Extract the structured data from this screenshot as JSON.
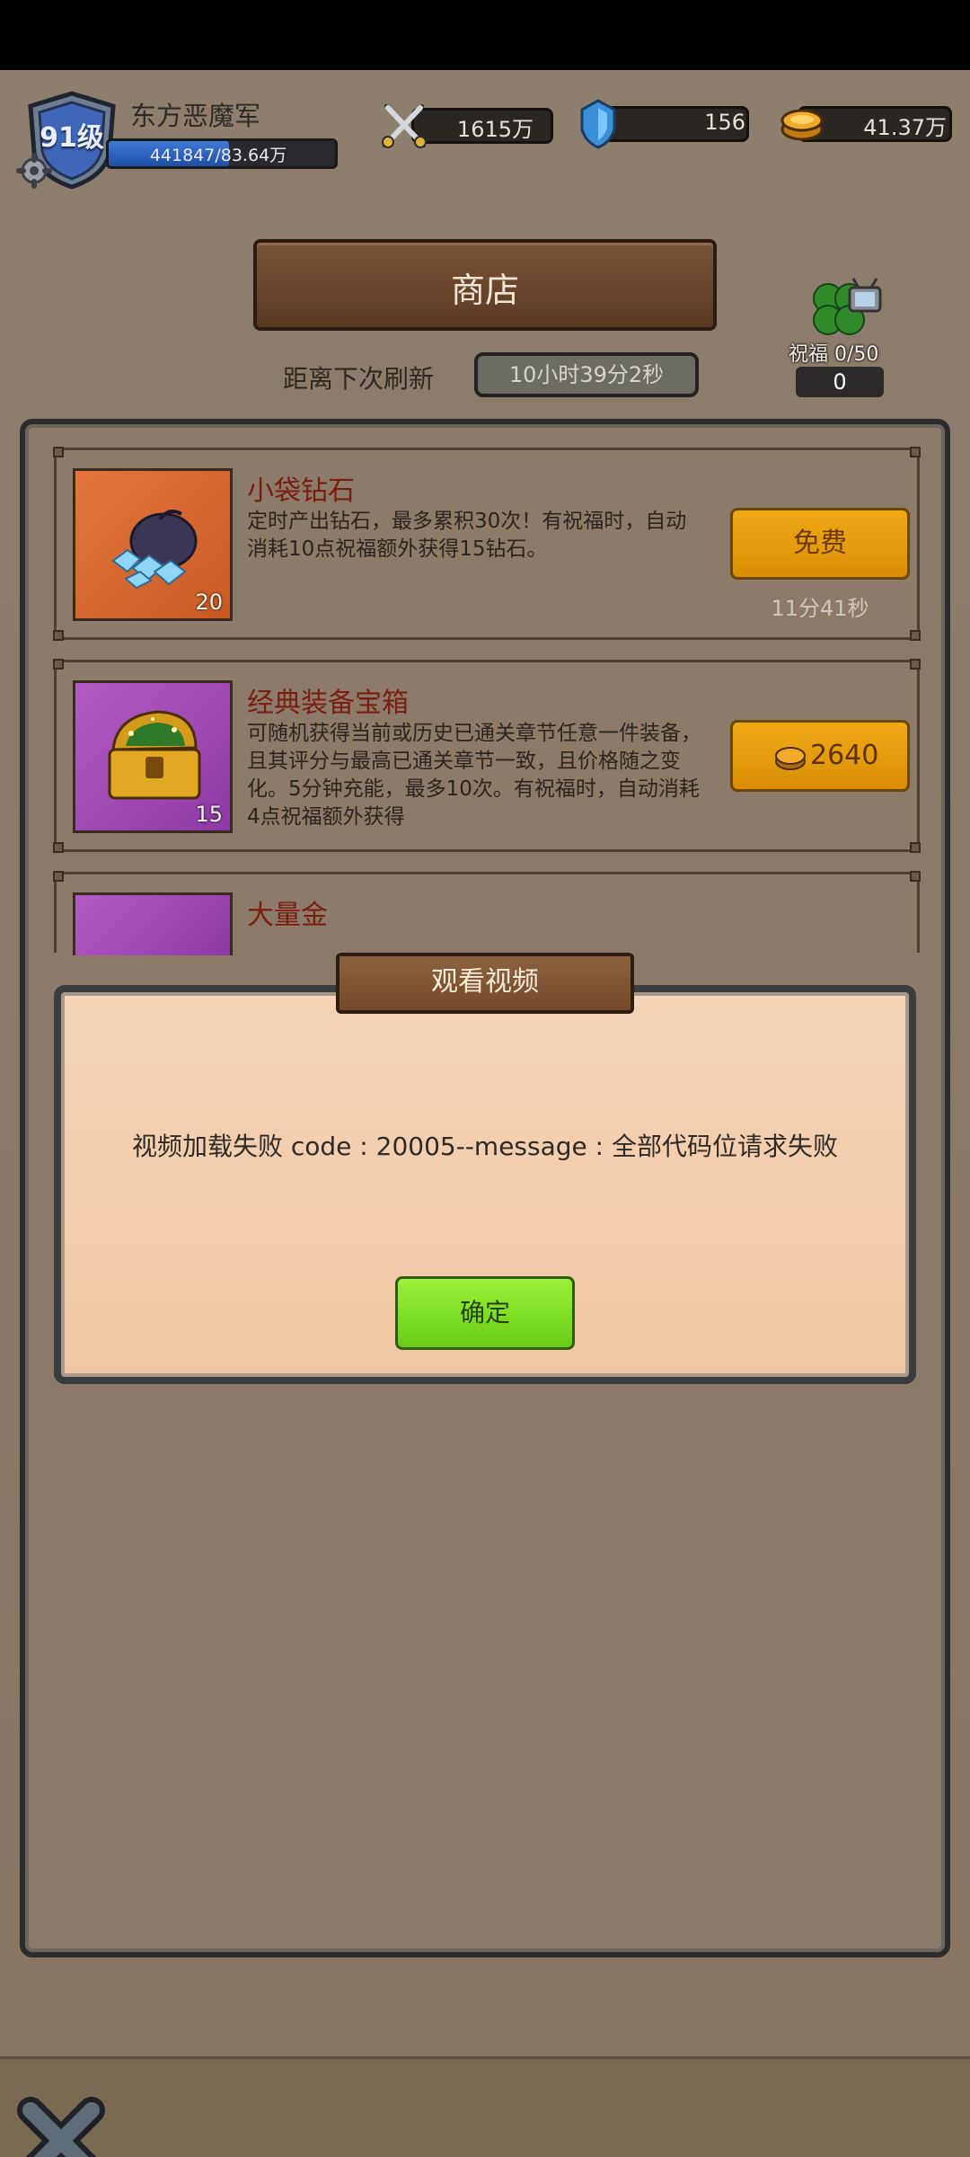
{
  "player": {
    "level": "91级",
    "name": "东方恶魔军",
    "xp_text": "441847/83.64万",
    "xp_fraction": 0.53
  },
  "resources": {
    "power": "1615万",
    "diamonds": "156",
    "gold": "41.37万"
  },
  "shop": {
    "title": "商店",
    "refresh_label": "距离下次刷新",
    "refresh_timer": "10小时39分2秒"
  },
  "blessing": {
    "label": "祝福 0/50",
    "count": "0"
  },
  "items": [
    {
      "name": "小袋钻石",
      "description": "定时产出钻石，最多累积30次！有祝福时，自动消耗10点祝福额外获得15钻石。",
      "quantity": "20",
      "button_label": "免费",
      "timer": "11分41秒"
    },
    {
      "name": "经典装备宝箱",
      "description": "可随机获得当前或历史已通关章节任意一件装备，且其评分与最高已通关章节一致，且价格随之变化。5分钟充能，最多10次。有祝福时，自动消耗4点祝福额外获得",
      "quantity": "15",
      "price": "2640"
    },
    {
      "name": "大量金"
    }
  ],
  "dialog": {
    "title": "观看视频",
    "message": "视频加载失败 code : 20005--message : 全部代码位请求失败",
    "ok_label": "确定"
  },
  "colors": {
    "accent_orange": "#e39a0b",
    "ok_green": "#7dde23",
    "item_name_red": "#7a1e12"
  }
}
